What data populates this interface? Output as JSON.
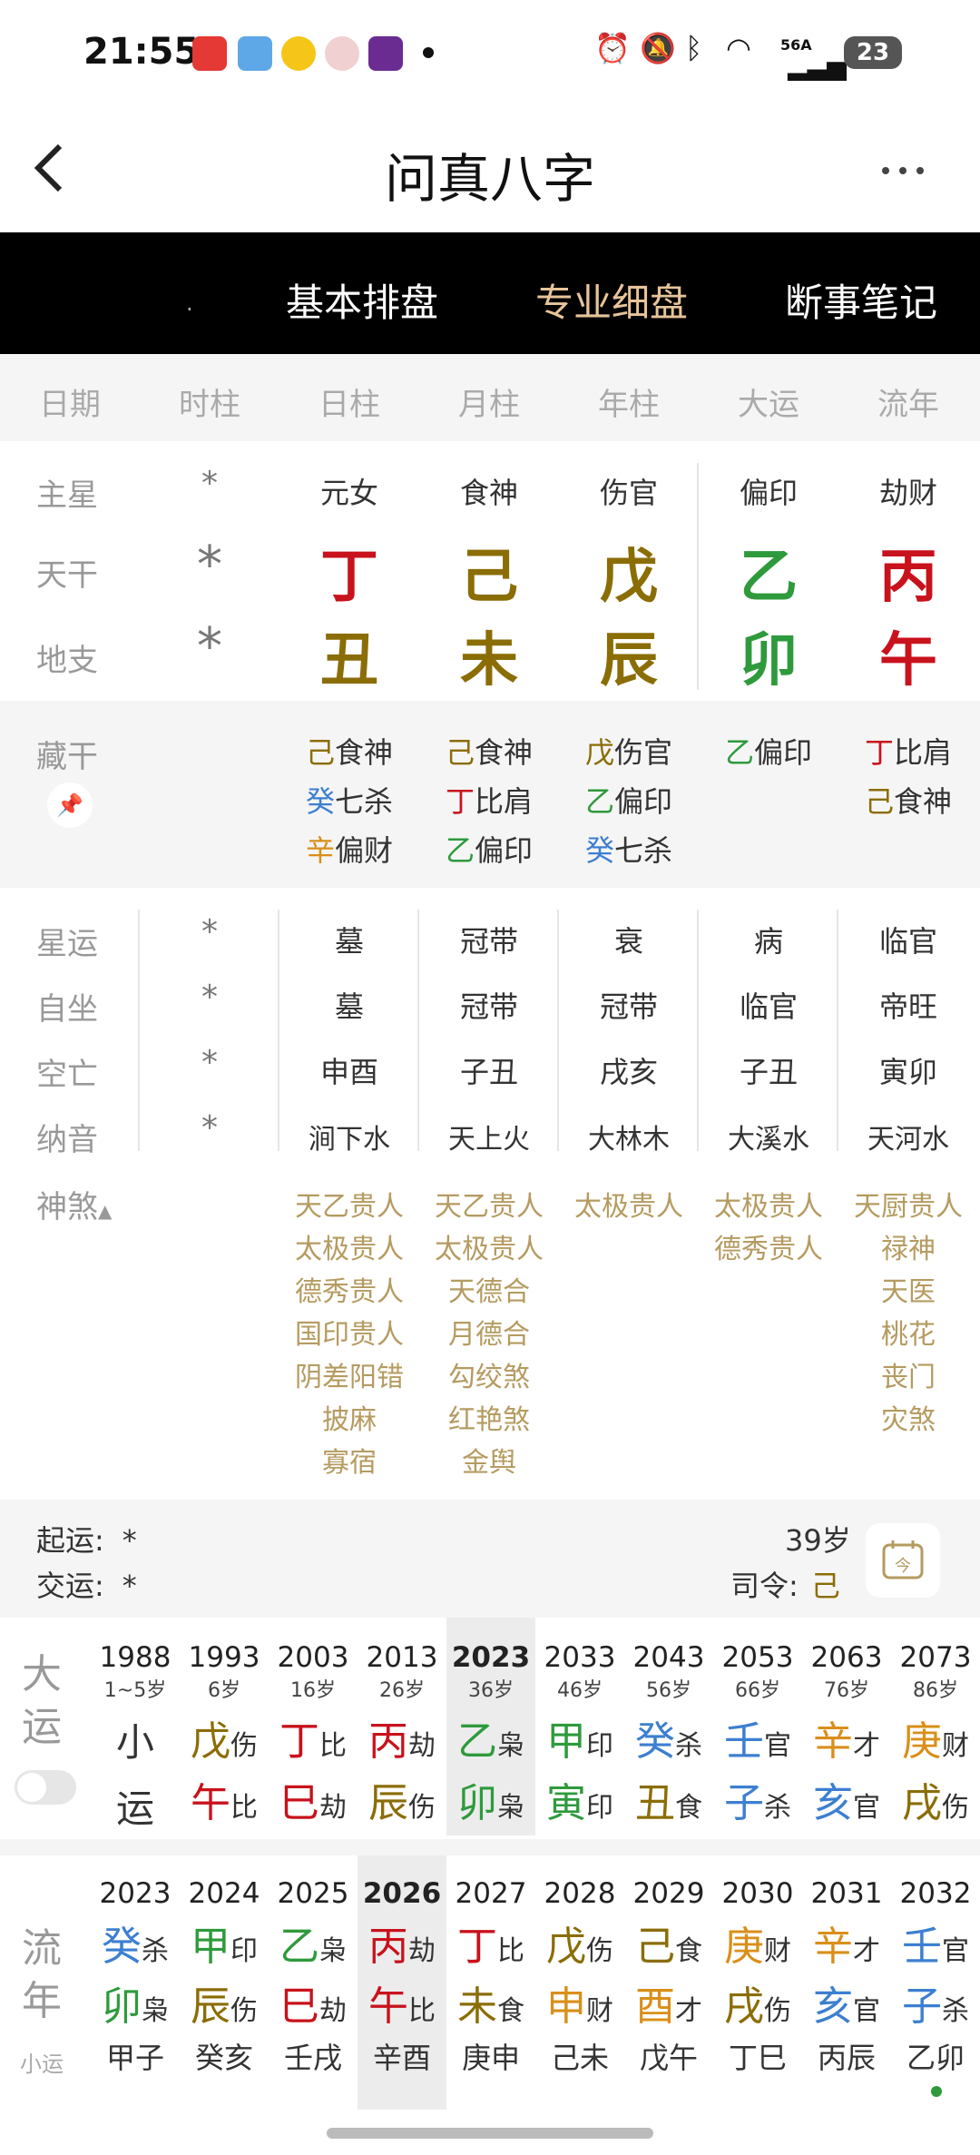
{
  "status": {
    "time": "21:55",
    "signal": "56A",
    "battery": "23"
  },
  "header": {
    "title": "问真八字",
    "back_icon": "chevron-left-icon",
    "more_icon": "more-dots-icon"
  },
  "tabs": [
    {
      "label": "."
    },
    {
      "label": "基本排盘"
    },
    {
      "label": "专业细盘"
    },
    {
      "label": "断事笔记"
    }
  ],
  "columns": [
    "日期",
    "时柱",
    "日柱",
    "月柱",
    "年柱",
    "大运",
    "流年"
  ],
  "rows": {
    "zhuxing": {
      "label": "主星",
      "values": [
        "*",
        "元女",
        "食神",
        "伤官",
        "偏印",
        "劫财"
      ]
    },
    "tiangan": {
      "label": "天干",
      "values": [
        "*",
        "丁",
        "己",
        "戊",
        "乙",
        "丙"
      ]
    },
    "dizhi": {
      "label": "地支",
      "values": [
        "*",
        "丑",
        "未",
        "辰",
        "卯",
        "午"
      ]
    }
  },
  "canggan": {
    "label": "藏干",
    "cols": [
      [],
      [
        {
          "g": "己",
          "s": "食神"
        },
        {
          "g": "癸",
          "s": "七杀"
        },
        {
          "g": "辛",
          "s": "偏财"
        }
      ],
      [
        {
          "g": "己",
          "s": "食神"
        },
        {
          "g": "丁",
          "s": "比肩"
        },
        {
          "g": "乙",
          "s": "偏印"
        }
      ],
      [
        {
          "g": "戊",
          "s": "伤官"
        },
        {
          "g": "乙",
          "s": "偏印"
        },
        {
          "g": "癸",
          "s": "七杀"
        }
      ],
      [
        {
          "g": "乙",
          "s": "偏印"
        }
      ],
      [
        {
          "g": "丁",
          "s": "比肩"
        },
        {
          "g": "己",
          "s": "食神"
        }
      ]
    ]
  },
  "xingyun": {
    "label": "星运",
    "values": [
      "*",
      "墓",
      "冠带",
      "衰",
      "病",
      "临官"
    ]
  },
  "zizuo": {
    "label": "自坐",
    "values": [
      "*",
      "墓",
      "冠带",
      "冠带",
      "临官",
      "帝旺"
    ]
  },
  "kongwang": {
    "label": "空亡",
    "values": [
      "*",
      "申酉",
      "子丑",
      "戌亥",
      "子丑",
      "寅卯"
    ]
  },
  "nayin": {
    "label": "纳音",
    "values": [
      "*",
      "涧下水",
      "天上火",
      "大林木",
      "大溪水",
      "天河水"
    ]
  },
  "shensha": {
    "label": "神煞",
    "cols": [
      [
        "天乙贵人",
        "太极贵人",
        "德秀贵人",
        "国印贵人",
        "阴差阳错",
        "披麻",
        "寡宿"
      ],
      [
        "天乙贵人",
        "太极贵人",
        "天德合",
        "月德合",
        "勾绞煞",
        "红艳煞",
        "金舆"
      ],
      [
        "太极贵人"
      ],
      [
        "太极贵人",
        "德秀贵人"
      ],
      [
        "天厨贵人",
        "禄神",
        "天医",
        "桃花",
        "丧门",
        "灾煞"
      ]
    ]
  },
  "qiyun": {
    "qiyun_label": "起运:",
    "qiyun_value": "*",
    "jiaoyun_label": "交运:",
    "jiaoyun_value": "*",
    "age": "39岁",
    "siling_label": "司令:",
    "siling_value": "己",
    "calendar_glyph": "今"
  },
  "dayun": {
    "label_top": "大",
    "label_bottom": "运",
    "cols": [
      {
        "year": "1988",
        "age": "1~5岁",
        "g": "小",
        "gs": "",
        "z": "运",
        "zs": ""
      },
      {
        "year": "1993",
        "age": "6岁",
        "g": "戊",
        "gs": "伤",
        "z": "午",
        "zs": "比"
      },
      {
        "year": "2003",
        "age": "16岁",
        "g": "丁",
        "gs": "比",
        "z": "巳",
        "zs": "劫"
      },
      {
        "year": "2013",
        "age": "26岁",
        "g": "丙",
        "gs": "劫",
        "z": "辰",
        "zs": "伤"
      },
      {
        "year": "2023",
        "age": "36岁",
        "g": "乙",
        "gs": "枭",
        "z": "卯",
        "zs": "枭"
      },
      {
        "year": "2033",
        "age": "46岁",
        "g": "甲",
        "gs": "印",
        "z": "寅",
        "zs": "印"
      },
      {
        "year": "2043",
        "age": "56岁",
        "g": "癸",
        "gs": "杀",
        "z": "丑",
        "zs": "食"
      },
      {
        "year": "2053",
        "age": "66岁",
        "g": "壬",
        "gs": "官",
        "z": "子",
        "zs": "杀"
      },
      {
        "year": "2063",
        "age": "76岁",
        "g": "辛",
        "gs": "才",
        "z": "亥",
        "zs": "官"
      },
      {
        "year": "2073",
        "age": "86岁",
        "g": "庚",
        "gs": "财",
        "z": "戌",
        "zs": "伤"
      }
    ]
  },
  "liunian": {
    "label_top": "流",
    "label_bottom": "年",
    "xiaoyun_label": "小运",
    "cols": [
      {
        "year": "2023",
        "g": "癸",
        "gs": "杀",
        "z": "卯",
        "zs": "枭",
        "xy": "甲子"
      },
      {
        "year": "2024",
        "g": "甲",
        "gs": "印",
        "z": "辰",
        "zs": "伤",
        "xy": "癸亥"
      },
      {
        "year": "2025",
        "g": "乙",
        "gs": "枭",
        "z": "巳",
        "zs": "劫",
        "xy": "壬戌"
      },
      {
        "year": "2026",
        "g": "丙",
        "gs": "劫",
        "z": "午",
        "zs": "比",
        "xy": "辛酉"
      },
      {
        "year": "2027",
        "g": "丁",
        "gs": "比",
        "z": "未",
        "zs": "食",
        "xy": "庚申"
      },
      {
        "year": "2028",
        "g": "戊",
        "gs": "伤",
        "z": "申",
        "zs": "财",
        "xy": "己未"
      },
      {
        "year": "2029",
        "g": "己",
        "gs": "食",
        "z": "酉",
        "zs": "才",
        "xy": "戊午"
      },
      {
        "year": "2030",
        "g": "庚",
        "gs": "财",
        "z": "戌",
        "zs": "伤",
        "xy": "丁巳"
      },
      {
        "year": "2031",
        "g": "辛",
        "gs": "才",
        "z": "亥",
        "zs": "官",
        "xy": "丙辰"
      },
      {
        "year": "2032",
        "g": "壬",
        "gs": "官",
        "z": "子",
        "zs": "杀",
        "xy": "乙卯"
      }
    ]
  },
  "colors": {
    "red": "#c8121c",
    "gold": "#8b6d05",
    "green": "#2e9a3c",
    "blue": "#3c7fd0",
    "orange": "#d98f1a",
    "shensha": "#b59b60",
    "accent_tab": "#e8c49a"
  }
}
